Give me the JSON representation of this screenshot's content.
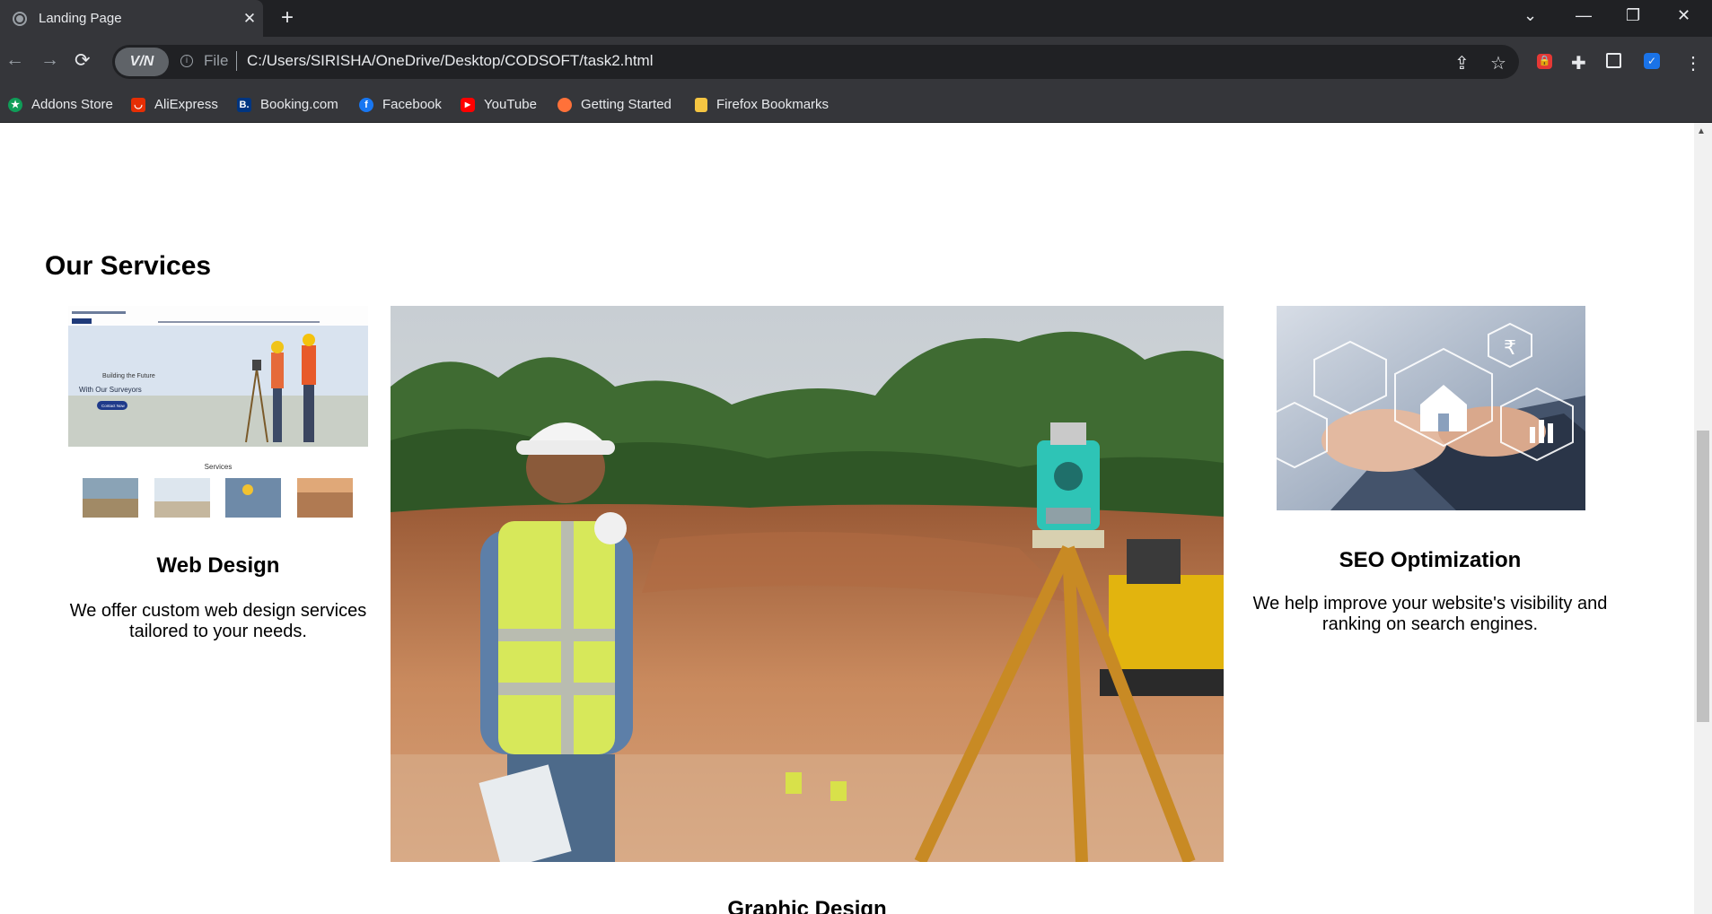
{
  "browser": {
    "tab_title": "Landing Page",
    "file_label": "File",
    "url": "C:/Users/SIRISHA/OneDrive/Desktop/CODSOFT/task2.html",
    "vpn_label": "V/N",
    "bookmarks": [
      {
        "label": "Addons Store",
        "icon": "addons-store-icon",
        "color": "#0f9d58"
      },
      {
        "label": "AliExpress",
        "icon": "aliexpress-icon",
        "color": "#e62e04"
      },
      {
        "label": "Booking.com",
        "icon": "booking-icon",
        "color": "#003580"
      },
      {
        "label": "Facebook",
        "icon": "facebook-icon",
        "color": "#1877f2"
      },
      {
        "label": "YouTube",
        "icon": "youtube-icon",
        "color": "#ff0000"
      },
      {
        "label": "Getting Started",
        "icon": "firefox-icon",
        "color": "#ff7139"
      },
      {
        "label": "Firefox Bookmarks",
        "icon": "folder-icon",
        "color": "#f5c542"
      }
    ]
  },
  "page": {
    "section_title": "Our Services",
    "services": [
      {
        "title": "Web Design",
        "description_line1": "We offer custom web design services",
        "description_line2": "tailored to your needs."
      },
      {
        "title": "Graphic Design"
      },
      {
        "title": "SEO Optimization",
        "description_line1": "We help improve your website's visibility and",
        "description_line2": "ranking on search engines."
      }
    ],
    "web_design_thumbnail": {
      "hero_line1": "Building the Future",
      "hero_line2": "With Our Surveyors",
      "button_label": "Contact Now",
      "section_label": "Services"
    },
    "seo_image_symbol": "₹"
  }
}
